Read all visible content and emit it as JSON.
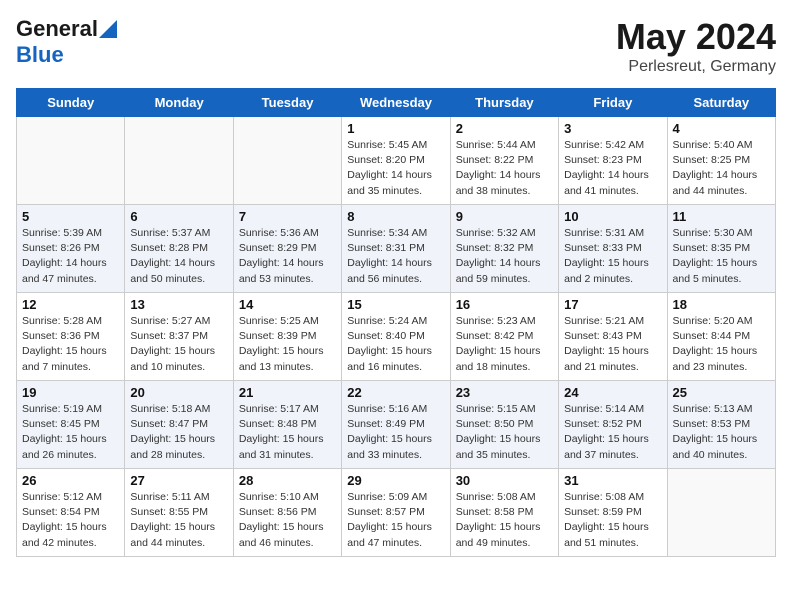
{
  "header": {
    "logo_general": "General",
    "logo_blue": "Blue",
    "title": "May 2024",
    "location": "Perlesreut, Germany"
  },
  "weekdays": [
    "Sunday",
    "Monday",
    "Tuesday",
    "Wednesday",
    "Thursday",
    "Friday",
    "Saturday"
  ],
  "weeks": [
    [
      {
        "day": "",
        "lines": []
      },
      {
        "day": "",
        "lines": []
      },
      {
        "day": "",
        "lines": []
      },
      {
        "day": "1",
        "lines": [
          "Sunrise: 5:45 AM",
          "Sunset: 8:20 PM",
          "Daylight: 14 hours",
          "and 35 minutes."
        ]
      },
      {
        "day": "2",
        "lines": [
          "Sunrise: 5:44 AM",
          "Sunset: 8:22 PM",
          "Daylight: 14 hours",
          "and 38 minutes."
        ]
      },
      {
        "day": "3",
        "lines": [
          "Sunrise: 5:42 AM",
          "Sunset: 8:23 PM",
          "Daylight: 14 hours",
          "and 41 minutes."
        ]
      },
      {
        "day": "4",
        "lines": [
          "Sunrise: 5:40 AM",
          "Sunset: 8:25 PM",
          "Daylight: 14 hours",
          "and 44 minutes."
        ]
      }
    ],
    [
      {
        "day": "5",
        "lines": [
          "Sunrise: 5:39 AM",
          "Sunset: 8:26 PM",
          "Daylight: 14 hours",
          "and 47 minutes."
        ]
      },
      {
        "day": "6",
        "lines": [
          "Sunrise: 5:37 AM",
          "Sunset: 8:28 PM",
          "Daylight: 14 hours",
          "and 50 minutes."
        ]
      },
      {
        "day": "7",
        "lines": [
          "Sunrise: 5:36 AM",
          "Sunset: 8:29 PM",
          "Daylight: 14 hours",
          "and 53 minutes."
        ]
      },
      {
        "day": "8",
        "lines": [
          "Sunrise: 5:34 AM",
          "Sunset: 8:31 PM",
          "Daylight: 14 hours",
          "and 56 minutes."
        ]
      },
      {
        "day": "9",
        "lines": [
          "Sunrise: 5:32 AM",
          "Sunset: 8:32 PM",
          "Daylight: 14 hours",
          "and 59 minutes."
        ]
      },
      {
        "day": "10",
        "lines": [
          "Sunrise: 5:31 AM",
          "Sunset: 8:33 PM",
          "Daylight: 15 hours",
          "and 2 minutes."
        ]
      },
      {
        "day": "11",
        "lines": [
          "Sunrise: 5:30 AM",
          "Sunset: 8:35 PM",
          "Daylight: 15 hours",
          "and 5 minutes."
        ]
      }
    ],
    [
      {
        "day": "12",
        "lines": [
          "Sunrise: 5:28 AM",
          "Sunset: 8:36 PM",
          "Daylight: 15 hours",
          "and 7 minutes."
        ]
      },
      {
        "day": "13",
        "lines": [
          "Sunrise: 5:27 AM",
          "Sunset: 8:37 PM",
          "Daylight: 15 hours",
          "and 10 minutes."
        ]
      },
      {
        "day": "14",
        "lines": [
          "Sunrise: 5:25 AM",
          "Sunset: 8:39 PM",
          "Daylight: 15 hours",
          "and 13 minutes."
        ]
      },
      {
        "day": "15",
        "lines": [
          "Sunrise: 5:24 AM",
          "Sunset: 8:40 PM",
          "Daylight: 15 hours",
          "and 16 minutes."
        ]
      },
      {
        "day": "16",
        "lines": [
          "Sunrise: 5:23 AM",
          "Sunset: 8:42 PM",
          "Daylight: 15 hours",
          "and 18 minutes."
        ]
      },
      {
        "day": "17",
        "lines": [
          "Sunrise: 5:21 AM",
          "Sunset: 8:43 PM",
          "Daylight: 15 hours",
          "and 21 minutes."
        ]
      },
      {
        "day": "18",
        "lines": [
          "Sunrise: 5:20 AM",
          "Sunset: 8:44 PM",
          "Daylight: 15 hours",
          "and 23 minutes."
        ]
      }
    ],
    [
      {
        "day": "19",
        "lines": [
          "Sunrise: 5:19 AM",
          "Sunset: 8:45 PM",
          "Daylight: 15 hours",
          "and 26 minutes."
        ]
      },
      {
        "day": "20",
        "lines": [
          "Sunrise: 5:18 AM",
          "Sunset: 8:47 PM",
          "Daylight: 15 hours",
          "and 28 minutes."
        ]
      },
      {
        "day": "21",
        "lines": [
          "Sunrise: 5:17 AM",
          "Sunset: 8:48 PM",
          "Daylight: 15 hours",
          "and 31 minutes."
        ]
      },
      {
        "day": "22",
        "lines": [
          "Sunrise: 5:16 AM",
          "Sunset: 8:49 PM",
          "Daylight: 15 hours",
          "and 33 minutes."
        ]
      },
      {
        "day": "23",
        "lines": [
          "Sunrise: 5:15 AM",
          "Sunset: 8:50 PM",
          "Daylight: 15 hours",
          "and 35 minutes."
        ]
      },
      {
        "day": "24",
        "lines": [
          "Sunrise: 5:14 AM",
          "Sunset: 8:52 PM",
          "Daylight: 15 hours",
          "and 37 minutes."
        ]
      },
      {
        "day": "25",
        "lines": [
          "Sunrise: 5:13 AM",
          "Sunset: 8:53 PM",
          "Daylight: 15 hours",
          "and 40 minutes."
        ]
      }
    ],
    [
      {
        "day": "26",
        "lines": [
          "Sunrise: 5:12 AM",
          "Sunset: 8:54 PM",
          "Daylight: 15 hours",
          "and 42 minutes."
        ]
      },
      {
        "day": "27",
        "lines": [
          "Sunrise: 5:11 AM",
          "Sunset: 8:55 PM",
          "Daylight: 15 hours",
          "and 44 minutes."
        ]
      },
      {
        "day": "28",
        "lines": [
          "Sunrise: 5:10 AM",
          "Sunset: 8:56 PM",
          "Daylight: 15 hours",
          "and 46 minutes."
        ]
      },
      {
        "day": "29",
        "lines": [
          "Sunrise: 5:09 AM",
          "Sunset: 8:57 PM",
          "Daylight: 15 hours",
          "and 47 minutes."
        ]
      },
      {
        "day": "30",
        "lines": [
          "Sunrise: 5:08 AM",
          "Sunset: 8:58 PM",
          "Daylight: 15 hours",
          "and 49 minutes."
        ]
      },
      {
        "day": "31",
        "lines": [
          "Sunrise: 5:08 AM",
          "Sunset: 8:59 PM",
          "Daylight: 15 hours",
          "and 51 minutes."
        ]
      },
      {
        "day": "",
        "lines": []
      }
    ]
  ]
}
